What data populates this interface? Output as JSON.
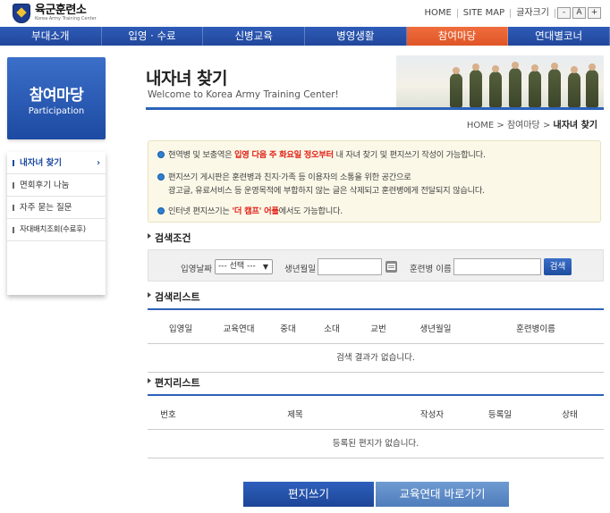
{
  "site": {
    "logo_title": "육군훈련소",
    "logo_subtitle": "Korea Army Training Center"
  },
  "util": {
    "home": "HOME",
    "sitemap": "SITE MAP",
    "font_size_label": "글자크기",
    "font_minus": "-",
    "font_reset": "A",
    "font_plus": "+"
  },
  "gnb": {
    "items": [
      "부대소개",
      "입영 · 수료",
      "신병교육",
      "병영생활",
      "참여마당",
      "연대별코너"
    ],
    "active_index": 4,
    "active_color": "#e8602f",
    "bar_color": "#2554ad"
  },
  "lnb": {
    "title": "참여마당",
    "subtitle": "Participation",
    "items": [
      "내자녀 찾기",
      "면회후기 나눔",
      "자주 묻는 질문",
      "자대배치조회(수료후)"
    ],
    "active_chevron": "›"
  },
  "page": {
    "title": "내자녀 찾기",
    "subtitle": "Welcome to Korea Army Training Center!",
    "breadcrumb": {
      "home": "HOME",
      "sep1": ">",
      "parent": "참여마당",
      "sep2": ">",
      "current": "내자녀 찾기"
    }
  },
  "notice": {
    "line1_pre": "현역병 및 보충역은 ",
    "line1_red": "입영 다음 주 화요일 정오부터",
    "line1_post": " 내 자녀 찾기 및 편지쓰기 작성이 가능합니다.",
    "line2": "편지쓰기 게시판은 훈련병과 친지·가족 등 이용자의 소통을 위한 공간으로",
    "line3": "광고글, 유료서비스 등 운영목적에 부합하지 않는 글은 삭제되고 훈련병에게 전달되지 않습니다.",
    "line4_pre": "인터넷 편지쓰기는 ",
    "line4_red": "'더 캠프' 어플",
    "line4_post": "에서도 가능합니다."
  },
  "search": {
    "section_title": "검색조건",
    "enlist_date_label": "입영날짜",
    "enlist_date_value": "--- 선택 ---",
    "birth_label": "생년월일",
    "birth_value": "",
    "name_label": "훈련병 이름",
    "name_value": "",
    "button": "검색"
  },
  "results": {
    "section_title": "검색리스트",
    "columns": [
      "입영일",
      "교육연대",
      "중대",
      "소대",
      "교번",
      "생년월일",
      "훈련병이름"
    ],
    "empty_text": "검색 결과가 없습니다."
  },
  "letters": {
    "section_title": "편지리스트",
    "columns": [
      "번호",
      "제목",
      "작성자",
      "등록일",
      "상태"
    ],
    "empty_text": "등록된 편지가 없습니다."
  },
  "actions": {
    "write_letter": "편지쓰기",
    "goto_regiment": "교육연대 바로가기"
  }
}
